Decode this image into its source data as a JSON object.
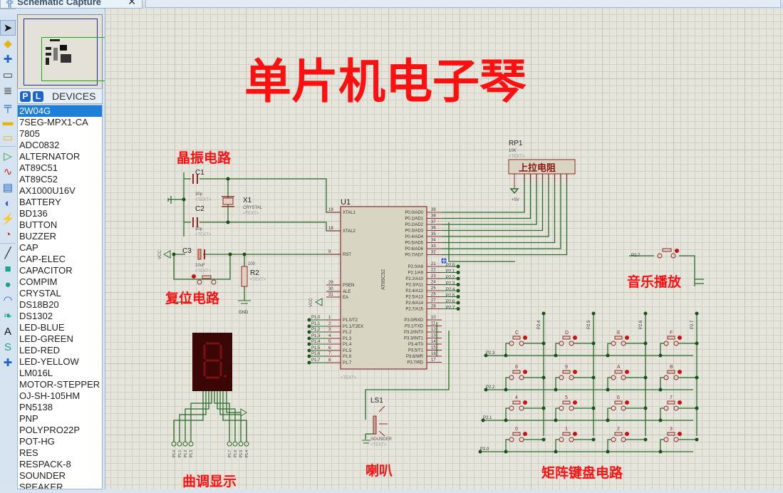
{
  "tab": {
    "label": "Schematic Capture",
    "icon": "schematic-icon",
    "close": "✕"
  },
  "device_panel": {
    "p_label": "P",
    "l_label": "L",
    "title": "DEVICES"
  },
  "devices": [
    "2W04G",
    "7SEG-MPX1-CA",
    "7805",
    "ADC0832",
    "ALTERNATOR",
    "AT89C51",
    "AT89C52",
    "AX1000U16V",
    "BATTERY",
    "BD136",
    "BUTTON",
    "BUZZER",
    "CAP",
    "CAP-ELEC",
    "CAPACITOR",
    "COMPIM",
    "CRYSTAL",
    "DS18B20",
    "DS1302",
    "LED-BLUE",
    "LED-GREEN",
    "LED-RED",
    "LED-YELLOW",
    "LM016L",
    "MOTOR-STEPPER",
    "OJ-SH-105HM",
    "PN5138",
    "PNP",
    "POLYPRO22P",
    "POT-HG",
    "RES",
    "RESPACK-8",
    "SOUNDER",
    "SPEAKER"
  ],
  "selected_device": "2W04G",
  "tools": [
    "selection-mode",
    "component-mode",
    "junction-dot",
    "wire-label",
    "text-script",
    "bus",
    "subcircuit",
    "terminals",
    "device-pins",
    "graph",
    "tape-recorder",
    "generator",
    "voltage-probe",
    "virtual-instruments",
    "2d-line",
    "2d-box",
    "2d-circle",
    "2d-arc",
    "2d-path",
    "2d-text",
    "2d-symbol",
    "2d-markers"
  ],
  "schematic": {
    "title": "单片机电子琴",
    "labels": {
      "crystal": "晶振电路",
      "reset": "复位电路",
      "pullup": "上拉电阻",
      "music": "音乐播放",
      "display": "曲调显示",
      "speaker": "喇叭",
      "keypad": "矩阵键盘电路"
    },
    "components": {
      "c1": {
        "ref": "C1",
        "value": "30p",
        "text": "<TEXT>"
      },
      "c2": {
        "ref": "C2",
        "value": "30p",
        "text": "<TEXT>"
      },
      "c3": {
        "ref": "C3",
        "value": "10uF",
        "text": "<TEXT>"
      },
      "x1": {
        "ref": "X1",
        "value": "CRYSTAL",
        "text": "<TEXT>"
      },
      "r2": {
        "ref": "R2",
        "value": "100",
        "text": "<TEXT>"
      },
      "rp1": {
        "ref": "RP1",
        "value": "10K",
        "text": "<TEXT>",
        "supply": "+5V"
      },
      "u1": {
        "ref": "U1",
        "part": "AT89C52",
        "text": "<TEXT>"
      },
      "ls1": {
        "ref": "LS1",
        "value": "SOUNDER",
        "text": "<TEXT>"
      },
      "vcc": "VCC",
      "gnd": "GND"
    },
    "u1_left_pins": [
      {
        "num": "19",
        "name": "XTAL1"
      },
      {
        "num": "18",
        "name": "XTAL2"
      },
      {
        "num": "9",
        "name": "RST"
      },
      {
        "num": "29",
        "name": "PSEN"
      },
      {
        "num": "30",
        "name": "ALE"
      },
      {
        "num": "31",
        "name": "EA"
      },
      {
        "num": "1",
        "name": "P1.0/T2"
      },
      {
        "num": "2",
        "name": "P1.1/T2EX"
      },
      {
        "num": "3",
        "name": "P1.2"
      },
      {
        "num": "4",
        "name": "P1.3"
      },
      {
        "num": "5",
        "name": "P1.4"
      },
      {
        "num": "6",
        "name": "P1.5"
      },
      {
        "num": "7",
        "name": "P1.6"
      },
      {
        "num": "8",
        "name": "P1.7"
      }
    ],
    "u1_right_pins": [
      {
        "num": "39",
        "name": "P0.0/AD0"
      },
      {
        "num": "38",
        "name": "P0.1/AD1"
      },
      {
        "num": "37",
        "name": "P0.2/AD2"
      },
      {
        "num": "36",
        "name": "P0.3/AD3"
      },
      {
        "num": "35",
        "name": "P0.4/AD4"
      },
      {
        "num": "34",
        "name": "P0.5/AD5"
      },
      {
        "num": "33",
        "name": "P0.6/AD6"
      },
      {
        "num": "32",
        "name": "P0.7/AD7"
      },
      {
        "num": "21",
        "name": "P2.0/A8"
      },
      {
        "num": "22",
        "name": "P2.1/A9"
      },
      {
        "num": "23",
        "name": "P2.2/A10"
      },
      {
        "num": "24",
        "name": "P2.3/A11"
      },
      {
        "num": "25",
        "name": "P2.4/A12"
      },
      {
        "num": "26",
        "name": "P2.5/A13"
      },
      {
        "num": "27",
        "name": "P2.6/A14"
      },
      {
        "num": "28",
        "name": "P2.7/A15"
      },
      {
        "num": "10",
        "name": "P3.0/RXD"
      },
      {
        "num": "11",
        "name": "P3.1/TXD"
      },
      {
        "num": "12",
        "name": "P3.2/INT0"
      },
      {
        "num": "13",
        "name": "P3.3/INT1"
      },
      {
        "num": "14",
        "name": "P3.4/T0"
      },
      {
        "num": "15",
        "name": "P3.5/T1"
      },
      {
        "num": "16",
        "name": "P3.6/WR"
      },
      {
        "num": "17",
        "name": "P3.7/RD"
      }
    ],
    "p2_net_labels": [
      "P2.0",
      "P2.1",
      "P2.2",
      "P2.3",
      "P2.4",
      "P2.5",
      "P2.6",
      "P2.7"
    ],
    "p1_net_labels": [
      "P1.0",
      "P1.1",
      "P1.2",
      "P1.3",
      "P1.4",
      "P1.5",
      "P1.6",
      "P1.7"
    ],
    "music_key_net": "P2.7",
    "display_nets_left": [
      "P1.0",
      "P1.1",
      "P1.2",
      "P1.3"
    ],
    "display_nets_right": [
      "P1.7",
      "P1.6",
      "P1.5",
      "P1.4"
    ],
    "keypad": {
      "row_nets": [
        "P2.3",
        "P2.2",
        "P2.1",
        "P2.0"
      ],
      "col_nets": [
        "P2.4",
        "P2.5",
        "P2.6",
        "P2.7"
      ],
      "keys": [
        [
          "C",
          "D",
          "E",
          "F"
        ],
        [
          "8",
          "9",
          "A",
          "B"
        ],
        [
          "4",
          "5",
          "6",
          "7"
        ],
        [
          "0",
          "1",
          "2",
          "3"
        ]
      ]
    }
  }
}
